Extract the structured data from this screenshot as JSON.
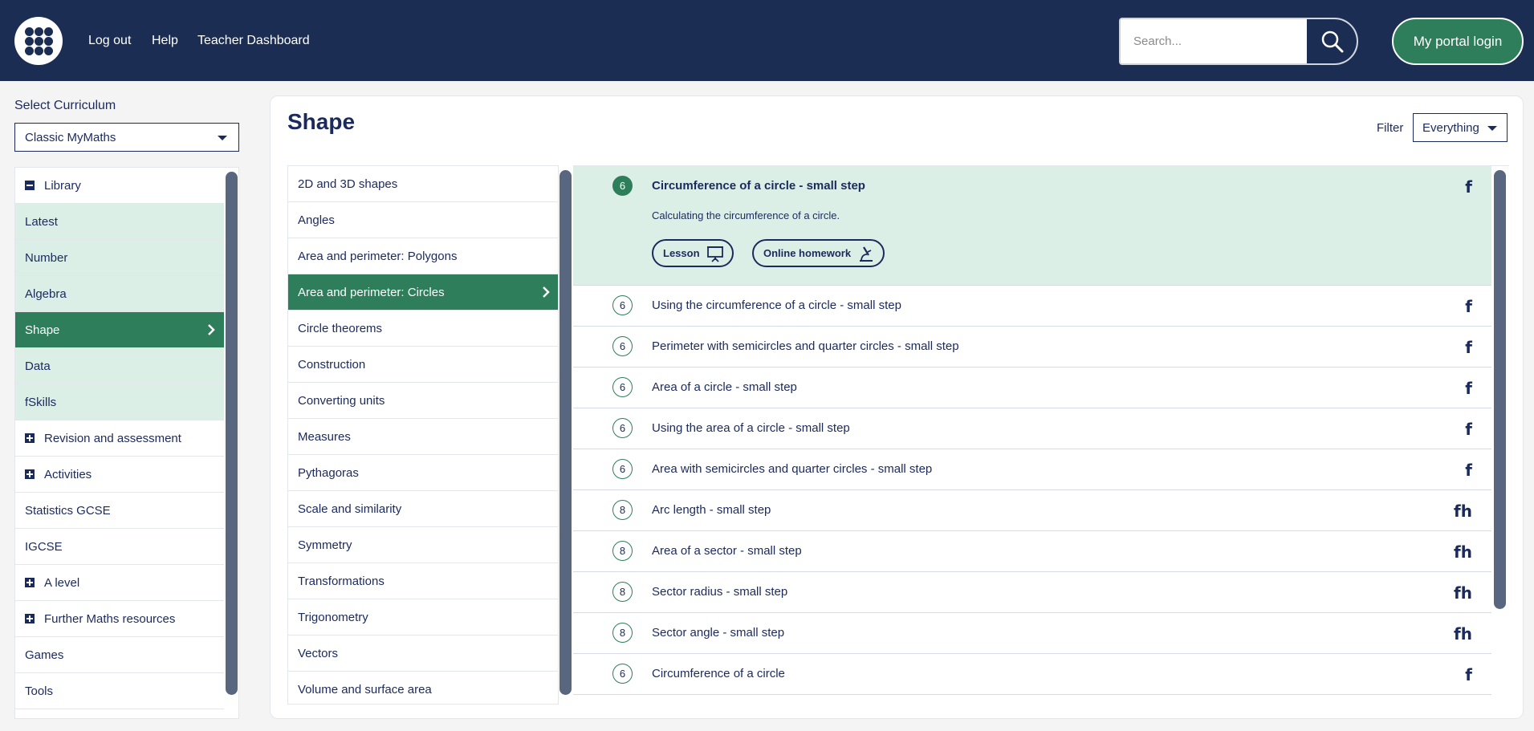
{
  "header": {
    "nav": [
      "Log out",
      "Help",
      "Teacher Dashboard"
    ],
    "search_placeholder": "Search...",
    "portal_label": "My portal login"
  },
  "sidebar": {
    "curriculum_label": "Select Curriculum",
    "curriculum_value": "Classic MyMaths",
    "items": [
      {
        "label": "Library",
        "icon": "minus-box-icon",
        "kind": "section"
      },
      {
        "label": "Latest",
        "kind": "sub"
      },
      {
        "label": "Number",
        "kind": "sub"
      },
      {
        "label": "Algebra",
        "kind": "sub"
      },
      {
        "label": "Shape",
        "kind": "active"
      },
      {
        "label": "Data",
        "kind": "sub"
      },
      {
        "label": "fSkills",
        "kind": "sub"
      },
      {
        "label": "Revision and assessment",
        "icon": "plus-box-icon",
        "kind": "section"
      },
      {
        "label": "Activities",
        "icon": "plus-box-icon",
        "kind": "section"
      },
      {
        "label": "Statistics GCSE",
        "kind": "plain"
      },
      {
        "label": "IGCSE",
        "kind": "plain"
      },
      {
        "label": "A level",
        "icon": "plus-box-icon",
        "kind": "section"
      },
      {
        "label": "Further Maths resources",
        "icon": "plus-box-icon",
        "kind": "section"
      },
      {
        "label": "Games",
        "kind": "plain"
      },
      {
        "label": "Tools",
        "kind": "plain"
      }
    ]
  },
  "main": {
    "title": "Shape",
    "filter_label": "Filter",
    "filter_value": "Everything",
    "topics": [
      "2D and 3D shapes",
      "Angles",
      "Area and perimeter: Polygons",
      "Area and perimeter: Circles",
      "Circle theorems",
      "Construction",
      "Converting units",
      "Measures",
      "Pythagoras",
      "Scale and similarity",
      "Symmetry",
      "Transformations",
      "Trigonometry",
      "Vectors",
      "Volume and surface area"
    ],
    "active_topic_index": 3,
    "lessons": [
      {
        "level": "6",
        "title": "Circumference of a circle - small step",
        "tier": "f",
        "expanded": true,
        "description": "Calculating the circumference of a circle.",
        "actions": [
          "Lesson",
          "Online homework"
        ]
      },
      {
        "level": "6",
        "title": "Using the circumference of a circle - small step",
        "tier": "f"
      },
      {
        "level": "6",
        "title": "Perimeter with semicircles and quarter circles - small step",
        "tier": "f"
      },
      {
        "level": "6",
        "title": "Area of a circle - small step",
        "tier": "f"
      },
      {
        "level": "6",
        "title": "Using the area of a circle - small step",
        "tier": "f"
      },
      {
        "level": "6",
        "title": "Area with semicircles and quarter circles - small step",
        "tier": "f"
      },
      {
        "level": "8",
        "title": "Arc length - small step",
        "tier": "fh"
      },
      {
        "level": "8",
        "title": "Area of a sector - small step",
        "tier": "fh"
      },
      {
        "level": "8",
        "title": "Sector radius - small step",
        "tier": "fh"
      },
      {
        "level": "8",
        "title": "Sector angle - small step",
        "tier": "fh"
      },
      {
        "level": "6",
        "title": "Circumference of a circle",
        "tier": "f"
      }
    ]
  },
  "colors": {
    "header": "#1b2d52",
    "accent_green": "#2e7d5b",
    "light_green": "#dcefe7",
    "text_navy": "#1b2a5c",
    "scrollbar": "#58667f"
  }
}
